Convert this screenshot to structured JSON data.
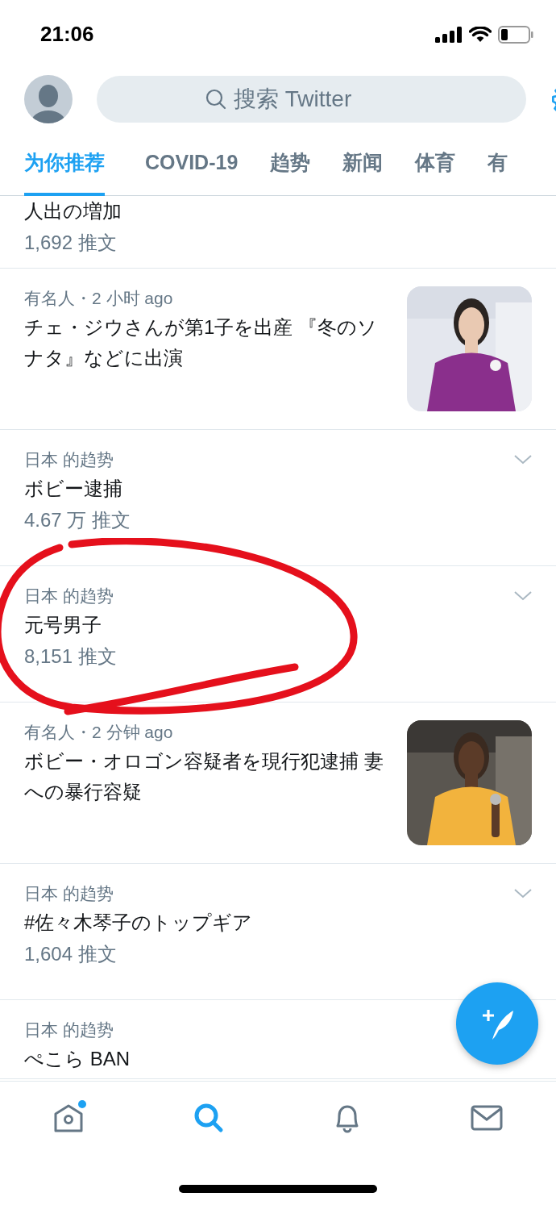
{
  "status_bar": {
    "time": "21:06"
  },
  "header": {
    "search": {
      "placeholder": "搜索 Twitter"
    }
  },
  "tabs": [
    {
      "label": "为你推荐",
      "selected": true
    },
    {
      "label": "COVID-19",
      "selected": false
    },
    {
      "label": "趋势",
      "selected": false
    },
    {
      "label": "新闻",
      "selected": false
    },
    {
      "label": "体育",
      "selected": false
    },
    {
      "label": "有",
      "selected": false
    }
  ],
  "items": [
    {
      "kind": "trend",
      "title": "人出の増加",
      "count": "1,692 推文"
    },
    {
      "kind": "news",
      "meta": "有名人・2 小时 ago",
      "headline": "チェ・ジウさんが第1子を出産 『冬のソナタ』などに出演"
    },
    {
      "kind": "trend",
      "meta": "日本 的趋势",
      "title": "ボビー逮捕",
      "count": "4.67 万 推文"
    },
    {
      "kind": "trend",
      "meta": "日本 的趋势",
      "title": "元号男子",
      "count": "8,151 推文"
    },
    {
      "kind": "news",
      "meta": "有名人・2 分钟 ago",
      "headline": "ボビー・オロゴン容疑者を現行犯逮捕 妻への暴行容疑"
    },
    {
      "kind": "trend",
      "meta": "日本 的趋势",
      "title": "#佐々木琴子のトップギア",
      "count": "1,604 推文"
    },
    {
      "kind": "trend",
      "meta": "日本 的趋势",
      "title": "ぺこら BAN"
    }
  ],
  "bottom_nav": [
    {
      "kind": "home",
      "selected": false,
      "dot": true
    },
    {
      "kind": "search",
      "selected": true,
      "dot": false
    },
    {
      "kind": "notifications",
      "selected": false,
      "dot": false
    },
    {
      "kind": "messages",
      "selected": false,
      "dot": false
    }
  ]
}
